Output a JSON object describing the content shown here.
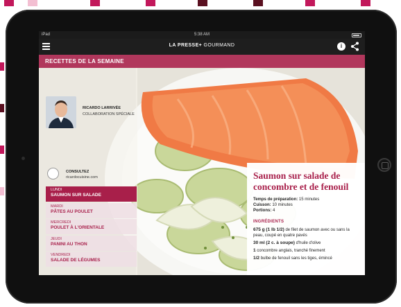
{
  "status": {
    "carrier": "iPad",
    "time": "5:38 AM"
  },
  "app": {
    "title_main": "LA PRESSE+",
    "title_sub": " GOURMAND",
    "info_glyph": "i"
  },
  "section": {
    "title": "RECETTES DE LA SEMAINE"
  },
  "author": {
    "name": "RICARDO LARRIVÉE",
    "role": "COLLABORATION SPÉCIALE"
  },
  "consult": {
    "label": "CONSULTEZ",
    "url": "ricardocuisine.com"
  },
  "days": [
    {
      "day": "LUNDI",
      "dish": "SAUMON SUR SALADE",
      "active": true
    },
    {
      "day": "MARDI",
      "dish": "PÂTES AU POULET",
      "active": false
    },
    {
      "day": "MERCREDI",
      "dish": "POULET À L'ORIENTALE",
      "active": false
    },
    {
      "day": "JEUDI",
      "dish": "PANINI AU THON",
      "active": false
    },
    {
      "day": "VENDREDI",
      "dish": "SALADE DE LÉGUMES",
      "active": false
    }
  ],
  "recipe": {
    "title": "Saumon sur salade de concombre et de fenouil",
    "prep_label": "Temps de préparation:",
    "prep_value": "15 minutes",
    "cook_label": "Cuisson:",
    "cook_value": "10 minutes",
    "portions_label": "Portions:",
    "portions_value": "4",
    "ingredients_title": "INGRÉDIENTS",
    "ingredients": [
      {
        "qty": "675 g (1 lb 1/2)",
        "text": " de filet de saumon avec ou sans la peau, coupé en quatre pavés"
      },
      {
        "qty": "30 ml (2 c. à soupe)",
        "text": " d'huile d'olive"
      },
      {
        "qty": "1",
        "text": " concombre anglais, tranché finement"
      },
      {
        "qty": "1/2",
        "text": " bulbe de fenouil sans les tiges, émincé"
      }
    ]
  },
  "colors": {
    "brand": "#a81f4a",
    "appbar": "#1e1e1e",
    "device": "#101010"
  }
}
